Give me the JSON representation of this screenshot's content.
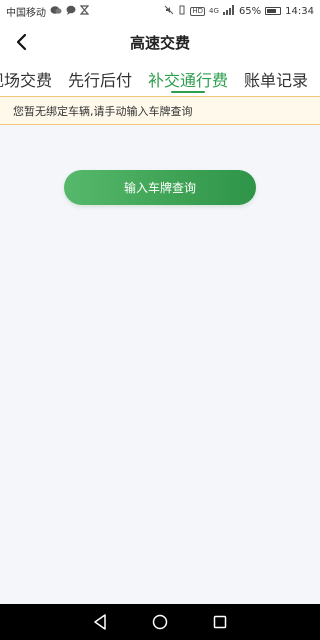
{
  "status_bar": {
    "carrier": "中国移动",
    "hd_badge": "HD",
    "network": "4G",
    "battery_percent": "65%",
    "time": "14:34"
  },
  "header": {
    "title": "高速交费"
  },
  "tabs": [
    {
      "label": "现场交费",
      "active": false
    },
    {
      "label": "先行后付",
      "active": false
    },
    {
      "label": "补交通行费",
      "active": true
    },
    {
      "label": "账单记录",
      "active": false
    }
  ],
  "notice": {
    "text": "您暂无绑定车辆,请手动输入车牌查询"
  },
  "actions": {
    "query_label": "输入车牌查询"
  },
  "colors": {
    "accent": "#2e9e4f",
    "notice_bg": "#fff9ec",
    "notice_border": "#f2c87c"
  },
  "icons": {
    "back": "chevron-left-icon",
    "nav_back": "triangle-back-icon",
    "nav_home": "circle-home-icon",
    "nav_recent": "square-recent-icon"
  }
}
